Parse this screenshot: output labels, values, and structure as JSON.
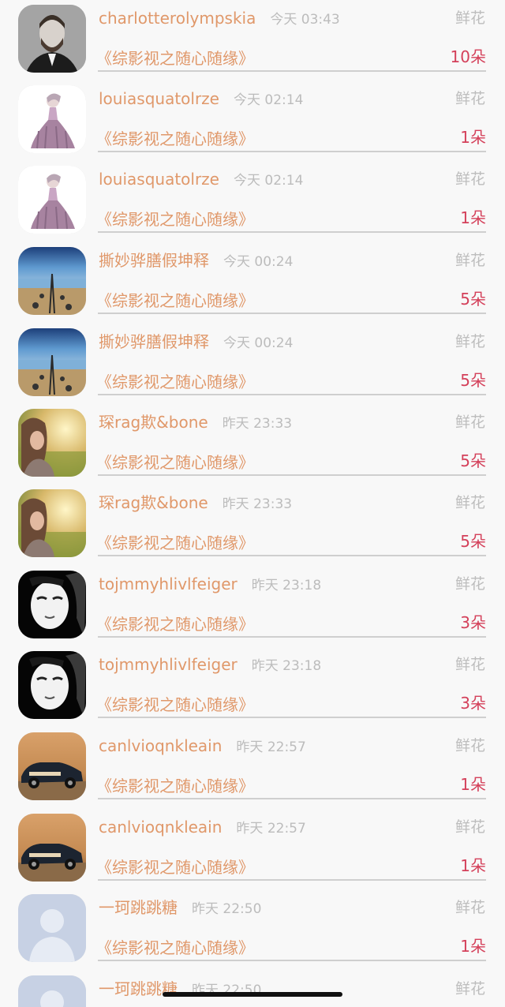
{
  "gift_label": "鲜花",
  "rows": [
    {
      "user": "charlotterolympskia",
      "time": "今天 03:43",
      "book": "《综影视之随心随缘》",
      "count": "10朵",
      "avatar_icon": "bearded-man-avatar-icon"
    },
    {
      "user": "louiasquatolrze",
      "time": "今天 02:14",
      "book": "《综影视之随心随缘》",
      "count": "1朵",
      "avatar_icon": "ballgown-girl-avatar-icon"
    },
    {
      "user": "louiasquatolrze",
      "time": "今天 02:14",
      "book": "《综影视之随心随缘》",
      "count": "1朵",
      "avatar_icon": "ballgown-girl-avatar-icon"
    },
    {
      "user": "撕妙骅膳假坤释",
      "time": "今天 00:24",
      "book": "《综影视之随心随缘》",
      "count": "5朵",
      "avatar_icon": "pier-sea-avatar-icon"
    },
    {
      "user": "撕妙骅膳假坤释",
      "time": "今天 00:24",
      "book": "《综影视之随心随缘》",
      "count": "5朵",
      "avatar_icon": "pier-sea-avatar-icon"
    },
    {
      "user": "琛rag欺&bone",
      "time": "昨天 23:33",
      "book": "《综影视之随心随缘》",
      "count": "5朵",
      "avatar_icon": "girl-sunset-avatar-icon"
    },
    {
      "user": "琛rag欺&bone",
      "time": "昨天 23:33",
      "book": "《综影视之随心随缘》",
      "count": "5朵",
      "avatar_icon": "girl-sunset-avatar-icon"
    },
    {
      "user": "tojmmyhlivlfeiger",
      "time": "昨天 23:18",
      "book": "《综影视之随心随缘》",
      "count": "3朵",
      "avatar_icon": "mask-face-avatar-icon"
    },
    {
      "user": "tojmmyhlivlfeiger",
      "time": "昨天 23:18",
      "book": "《综影视之随心随缘》",
      "count": "3朵",
      "avatar_icon": "mask-face-avatar-icon"
    },
    {
      "user": "canlvioqnkleain",
      "time": "昨天 22:57",
      "book": "《综影视之随心随缘》",
      "count": "1朵",
      "avatar_icon": "toy-car-avatar-icon"
    },
    {
      "user": "canlvioqnkleain",
      "time": "昨天 22:57",
      "book": "《综影视之随心随缘》",
      "count": "1朵",
      "avatar_icon": "toy-car-avatar-icon"
    },
    {
      "user": "一珂跳跳糖",
      "time": "昨天 22:50",
      "book": "《综影视之随心随缘》",
      "count": "1朵",
      "avatar_icon": "default-user-avatar-icon"
    },
    {
      "user": "一珂跳跳糖",
      "time": "昨天 22:50",
      "book": "",
      "count": "",
      "avatar_icon": "default-user-avatar-icon"
    }
  ],
  "colors": {
    "username": "#e0986a",
    "book": "#e0986a",
    "count": "#d4405a",
    "muted": "#bdbdbd",
    "background": "#f8f8f8"
  }
}
